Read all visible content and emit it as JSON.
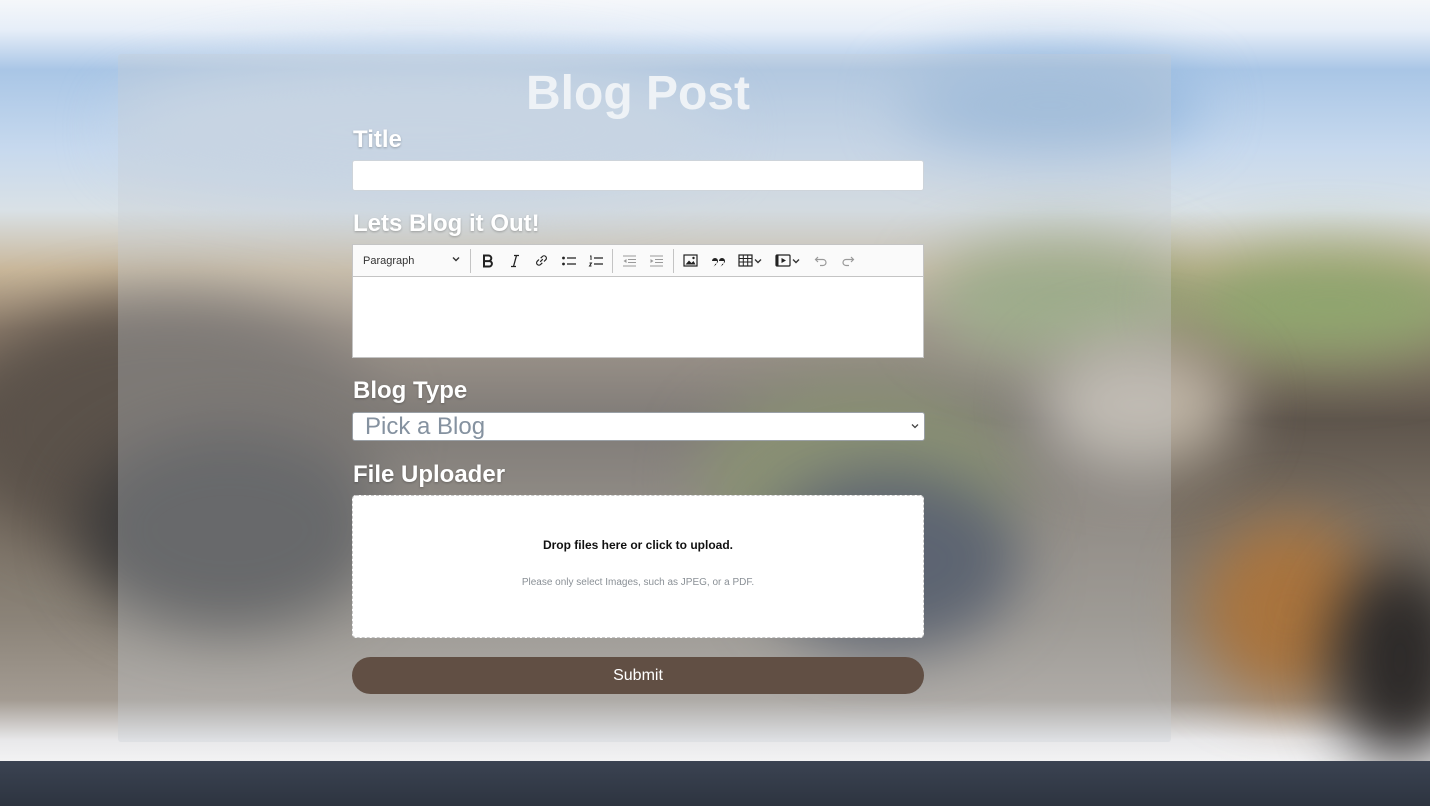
{
  "page": {
    "heading": "Blog Post",
    "accent_color": "#614f44",
    "footer_color": "#343b48"
  },
  "form": {
    "title_label": "Title",
    "title_value": "",
    "editor_label": "Lets Blog it Out!",
    "editor_content": "",
    "blog_type_label": "Blog Type",
    "blog_type_selected": "Pick a Blog",
    "uploader_label": "File Uploader",
    "dropzone_text": "Drop files here or click to upload.",
    "dropzone_hint": "Please only select Images, such as JPEG, or a PDF.",
    "submit_label": "Submit"
  },
  "toolbar": {
    "heading_selected": "Paragraph",
    "buttons": [
      "bold-icon",
      "italic-icon",
      "link-icon",
      "bulleted-list-icon",
      "numbered-list-icon",
      "outdent-icon",
      "indent-icon",
      "image-icon",
      "blockquote-icon",
      "table-icon",
      "media-icon",
      "undo-icon",
      "redo-icon"
    ]
  }
}
